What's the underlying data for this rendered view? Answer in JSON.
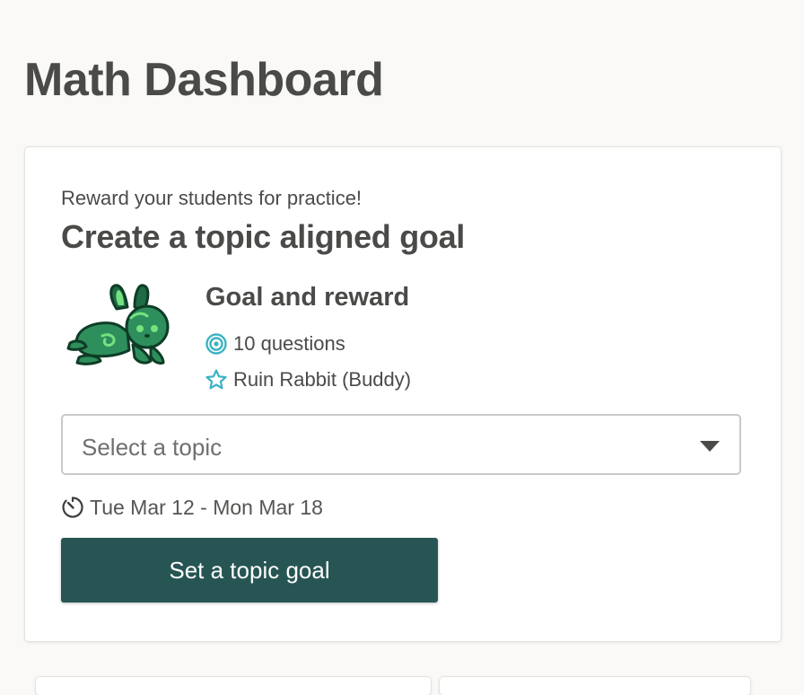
{
  "page": {
    "title": "Math Dashboard"
  },
  "goal_card": {
    "eyebrow": "Reward your students for practice!",
    "title": "Create a topic aligned goal",
    "reward": {
      "heading": "Goal and reward",
      "questions": "10 questions",
      "buddy": "Ruin Rabbit (Buddy)",
      "questions_icon": "target-icon",
      "buddy_icon": "star-icon",
      "buddy_image": "rabbit-buddy"
    },
    "topic_select": {
      "placeholder": "Select a topic",
      "icon": "chevron-down-icon"
    },
    "date_range": {
      "text": "Tue Mar 12 - Mon Mar 18",
      "icon": "timer-icon"
    },
    "button_label": "Set a topic goal"
  },
  "colors": {
    "primary_button": "#265553",
    "accent_icon": "#3bb3c3",
    "background": "#faf9f7"
  }
}
